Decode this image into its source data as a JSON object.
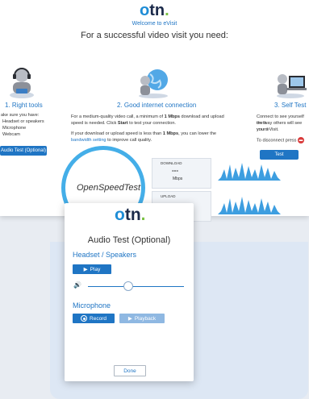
{
  "background": {
    "logo": "otn.",
    "welcome": "Welcome to eVisit",
    "subtitle": "For a successful video visit you need:",
    "col1": {
      "title": "1. Right tools",
      "lines": [
        "ake sure you have:",
        "Headset or speakers",
        "Microphone",
        "Webcam"
      ],
      "button": "Audio Test (Optional)"
    },
    "col2": {
      "title": "2. Good internet connection",
      "line1a": "For a medium-quality video call, a minimum of ",
      "line1b": "1 Mbps",
      "line1c": " download and upload",
      "line2a": "speed is needed. Click ",
      "line2b": "Start",
      "line2c": " to test your connection.",
      "line3a": "If your download or upload speed is less than ",
      "line3b": "1 Mbps",
      "line3c": ", you can lower the",
      "line4a": "bandwidth setting",
      "line4b": " to improve call quality.",
      "speedtest_label": "OpenSpeedTest",
      "download_label": "DOWNLOAD",
      "upload_label": "UPLOAD",
      "dash": "---",
      "unit": "Mbps"
    },
    "col3": {
      "title": "3. Self Test",
      "line1": "Connect to see yourself on th",
      "line2": "the way others will see you d",
      "line3": "your eVisit.",
      "line4": "To disconnect press",
      "button": "Test"
    }
  },
  "dialog": {
    "logo": "otn.",
    "title": "Audio Test (Optional)",
    "headset_label": "Headset / Speakers",
    "play_label": "Play",
    "volume_level": 0.42,
    "microphone_label": "Microphone",
    "record_label": "Record",
    "playback_label": "Playback",
    "done_label": "Done"
  },
  "colors": {
    "accent": "#1f75c4",
    "brand_dark": "#1b2a4a",
    "brand_green": "#7ac143",
    "ring": "#44aee8"
  }
}
